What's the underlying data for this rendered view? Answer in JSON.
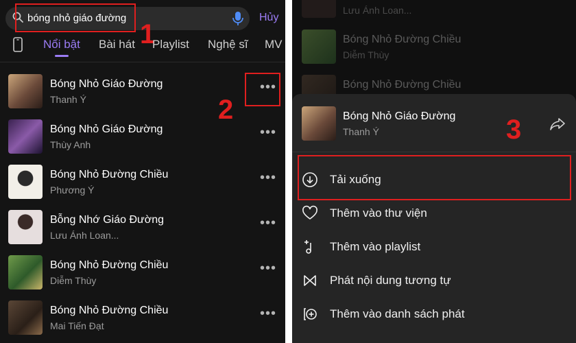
{
  "search": {
    "query": "bóng nhỏ giáo đường",
    "cancel_label": "Hủy"
  },
  "tabs": [
    {
      "label": "Nổi bật",
      "active": true
    },
    {
      "label": "Bài hát",
      "active": false
    },
    {
      "label": "Playlist",
      "active": false
    },
    {
      "label": "Nghệ sĩ",
      "active": false
    },
    {
      "label": "MV",
      "active": false
    }
  ],
  "results": [
    {
      "title": "Bóng Nhỏ Giáo Đường",
      "artist": "Thanh Ý",
      "thumb_color": "#7a5b48"
    },
    {
      "title": "Bóng Nhỏ Giáo Đường",
      "artist": "Thùy Anh",
      "thumb_color": "#5a3a6e"
    },
    {
      "title": "Bóng Nhỏ Đường Chiều",
      "artist": "Phương Ý",
      "thumb_color": "#e8e4dc"
    },
    {
      "title": "Bỗng Nhớ Giáo Đường",
      "artist": "Lưu Ánh Loan...",
      "thumb_color": "#d9d2d2"
    },
    {
      "title": "Bóng Nhỏ Đường Chiều",
      "artist": "Diễm Thùy",
      "thumb_color": "#3f6a3a"
    },
    {
      "title": "Bóng Nhỏ Đường Chiều",
      "artist": "Mai Tiến Đạt",
      "thumb_color": "#4a3a2e"
    }
  ],
  "annotations": {
    "step1": "1",
    "step2": "2",
    "step3": "3",
    "color": "#e01f1f"
  },
  "background_list": [
    {
      "title": "",
      "artist": "Lưu Ánh Loan..."
    },
    {
      "title": "Bóng Nhỏ Đường Chiều",
      "artist": "Diễm Thùy"
    },
    {
      "title": "Bóng Nhỏ Đường Chiều",
      "artist": ""
    }
  ],
  "sheet": {
    "song_title": "Bóng Nhỏ Giáo Đường",
    "song_artist": "Thanh Ý",
    "items": [
      {
        "label": "Tải xuống",
        "icon": "download-icon"
      },
      {
        "label": "Thêm vào thư viện",
        "icon": "heart-icon"
      },
      {
        "label": "Thêm vào playlist",
        "icon": "add-to-playlist-icon"
      },
      {
        "label": "Phát nội dung tương tự",
        "icon": "similar-content-icon"
      },
      {
        "label": "Thêm vào danh sách phát",
        "icon": "queue-add-icon"
      }
    ]
  },
  "colors": {
    "accent": "#9b7cf4",
    "background": "#141414",
    "sheet": "#252525"
  }
}
